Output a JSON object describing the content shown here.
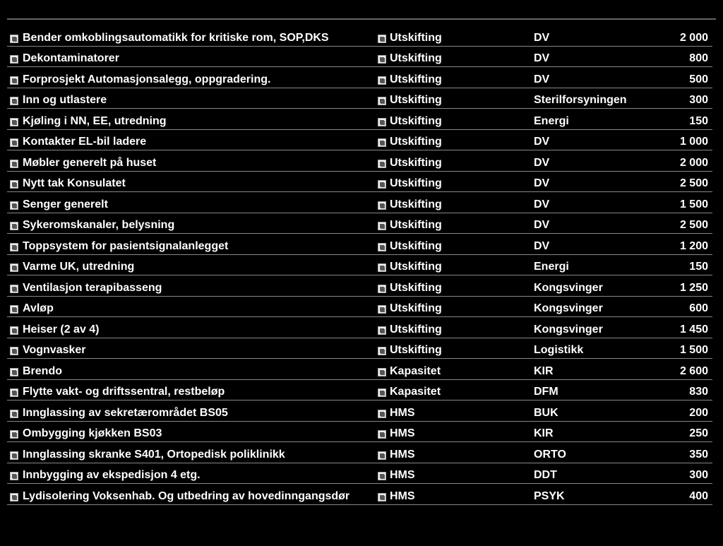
{
  "rows": [
    {
      "name": "Bender omkoblingsautomatikk for kritiske rom, SOP,DKS",
      "cat": "Utskifting",
      "dept": "DV",
      "num": "2 000"
    },
    {
      "name": "Dekontaminatorer",
      "cat": "Utskifting",
      "dept": "DV",
      "num": "800"
    },
    {
      "name": "Forprosjekt Automasjonsalegg, oppgradering.",
      "cat": "Utskifting",
      "dept": "DV",
      "num": "500"
    },
    {
      "name": "Inn og utlastere",
      "cat": "Utskifting",
      "dept": "Sterilforsyningen",
      "num": "300"
    },
    {
      "name": "Kjøling i NN, EE, utredning",
      "cat": "Utskifting",
      "dept": "Energi",
      "num": "150"
    },
    {
      "name": "Kontakter EL-bil ladere",
      "cat": "Utskifting",
      "dept": "DV",
      "num": "1 000"
    },
    {
      "name": "Møbler generelt på huset",
      "cat": "Utskifting",
      "dept": "DV",
      "num": "2 000"
    },
    {
      "name": "Nytt tak Konsulatet",
      "cat": "Utskifting",
      "dept": "DV",
      "num": "2 500"
    },
    {
      "name": "Senger generelt",
      "cat": "Utskifting",
      "dept": "DV",
      "num": "1 500"
    },
    {
      "name": "Sykeromskanaler, belysning",
      "cat": "Utskifting",
      "dept": "DV",
      "num": "2 500"
    },
    {
      "name": "Toppsystem for pasientsignalanlegget",
      "cat": "Utskifting",
      "dept": "DV",
      "num": "1 200"
    },
    {
      "name": "Varme UK, utredning",
      "cat": "Utskifting",
      "dept": "Energi",
      "num": "150"
    },
    {
      "name": "Ventilasjon terapibasseng",
      "cat": "Utskifting",
      "dept": "Kongsvinger",
      "num": "1 250"
    },
    {
      "name": "Avløp",
      "cat": "Utskifting",
      "dept": "Kongsvinger",
      "num": "600"
    },
    {
      "name": "Heiser (2 av 4)",
      "cat": "Utskifting",
      "dept": "Kongsvinger",
      "num": "1 450"
    },
    {
      "name": "Vognvasker",
      "cat": "Utskifting",
      "dept": "Logistikk",
      "num": "1 500"
    },
    {
      "name": "Brendo",
      "cat": "Kapasitet",
      "dept": "KIR",
      "num": "2 600"
    },
    {
      "name": "Flytte vakt- og driftssentral, restbeløp",
      "cat": "Kapasitet",
      "dept": "DFM",
      "num": "830"
    },
    {
      "name": "Innglassing av sekretærområdet BS05",
      "cat": "HMS",
      "dept": "BUK",
      "num": "200"
    },
    {
      "name": "Ombygging kjøkken BS03",
      "cat": "HMS",
      "dept": "KIR",
      "num": "250"
    },
    {
      "name": "Innglassing skranke S401, Ortopedisk poliklinikk",
      "cat": "HMS",
      "dept": "ORTO",
      "num": "350"
    },
    {
      "name": "Innbygging av ekspedisjon 4 etg.",
      "cat": "HMS",
      "dept": "DDT",
      "num": "300"
    },
    {
      "name": "Lydisolering Voksenhab. Og utbedring av hovedinngangsdør",
      "cat": "HMS",
      "dept": "PSYK",
      "num": "400"
    }
  ]
}
